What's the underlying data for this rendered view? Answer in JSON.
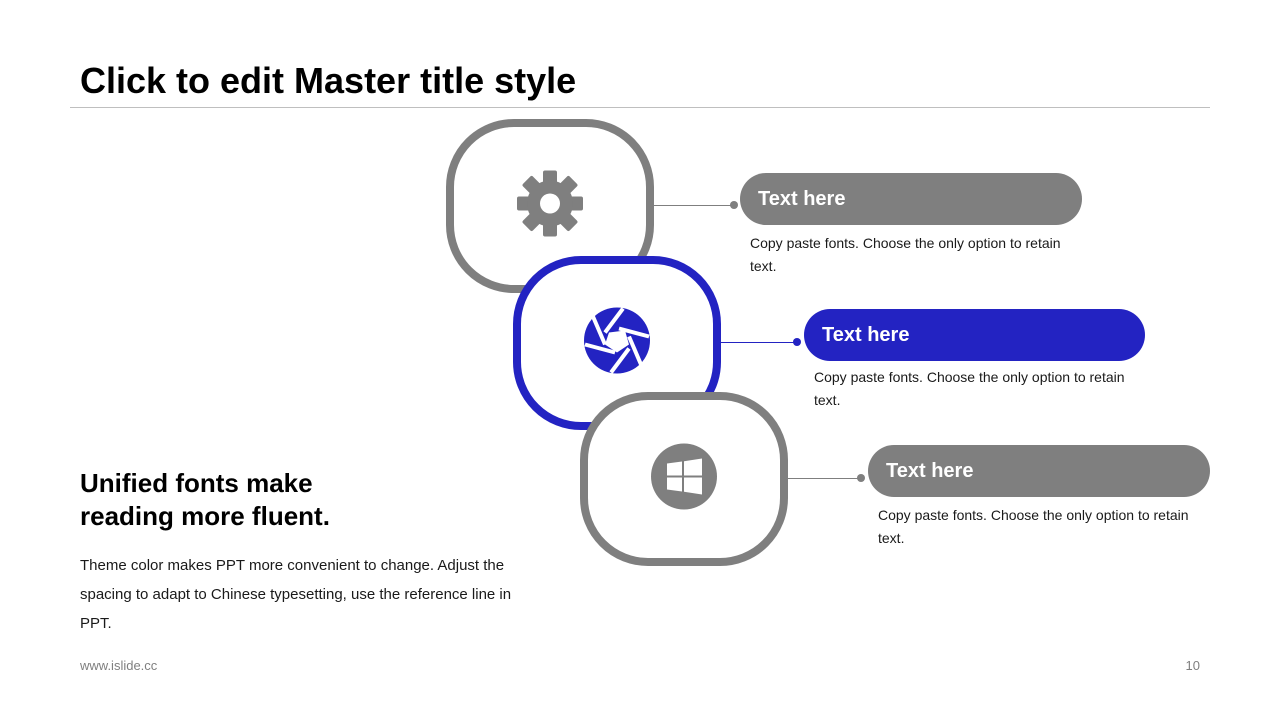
{
  "slide": {
    "title": "Click to edit Master title style",
    "subheading": "Unified fonts make reading more fluent.",
    "body": "Theme color makes PPT more convenient to change. Adjust the spacing to adapt to Chinese typesetting, use the reference line in PPT.",
    "footer_url": "www.islide.cc",
    "page_number": "10"
  },
  "items": [
    {
      "icon": "gear-icon",
      "label": "Text here",
      "description": "Copy paste fonts. Choose the only option to retain text.",
      "color": "#7f7f7f"
    },
    {
      "icon": "aperture-icon",
      "label": "Text here",
      "description": "Copy paste fonts. Choose the only option to retain text.",
      "color": "#2323c2"
    },
    {
      "icon": "windows-icon",
      "label": "Text here",
      "description": "Copy paste fonts. Choose the only option to retain text.",
      "color": "#7f7f7f"
    }
  ],
  "colors": {
    "accent": "#2323c2",
    "neutral": "#7f7f7f",
    "rule": "#bfbfbf"
  }
}
